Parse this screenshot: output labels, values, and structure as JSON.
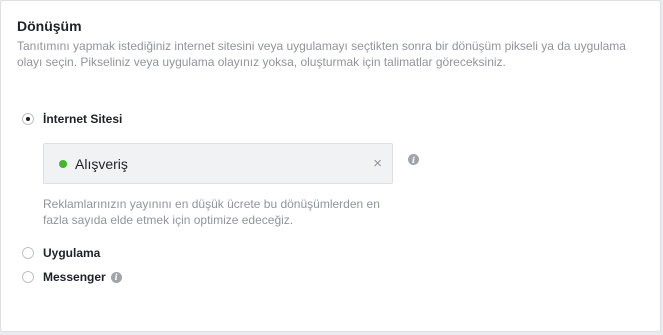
{
  "section": {
    "title": "Dönüşüm",
    "description": "Tanıtımını yapmak istediğiniz internet sitesini veya uygulamayı seçtikten sonra bir dönüşüm pikseli ya da uygulama olayı seçin. Pikseliniz veya uygulama olayınız yoksa, oluşturmak için talimatlar göreceksiniz."
  },
  "options": {
    "website": {
      "label": "İnternet Sitesi",
      "selected": true
    },
    "app": {
      "label": "Uygulama",
      "selected": false
    },
    "messenger": {
      "label": "Messenger",
      "selected": false
    }
  },
  "conversion_event": {
    "label": "Alışveriş",
    "status_color": "#42b72a",
    "remove_icon": "×",
    "info_icon": "i"
  },
  "hint": "Reklamlarınızın yayınını en düşük ücrete bu dönüşümlerden en fazla sayıda elde etmek için optimize edeceğiz.",
  "messenger_info_icon": "i"
}
